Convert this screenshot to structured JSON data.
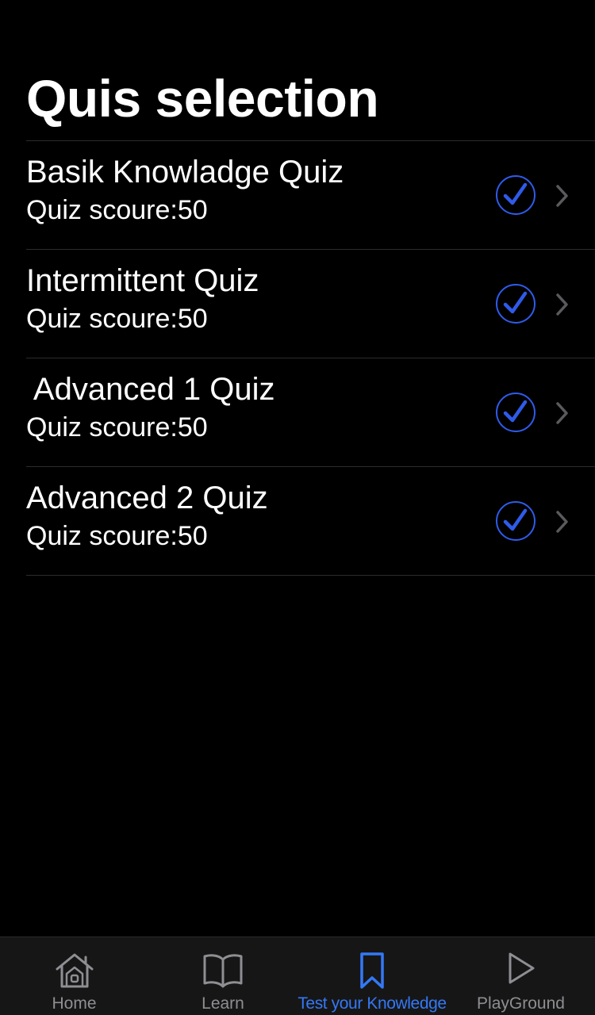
{
  "page": {
    "title": "Quis selection"
  },
  "quizzes": [
    {
      "title": "Basik Knowladge Quiz",
      "score": "Quiz scoure:50",
      "completed": true
    },
    {
      "title": "Intermittent Quiz",
      "score": "Quiz scoure:50",
      "completed": true
    },
    {
      "title": " Advanced 1 Quiz",
      "score": "Quiz scoure:50",
      "completed": true
    },
    {
      "title": "Advanced 2 Quiz",
      "score": "Quiz scoure:50",
      "completed": true
    }
  ],
  "tab_bar": {
    "items": [
      {
        "label": "Home",
        "icon": "house-icon",
        "active": false
      },
      {
        "label": "Learn",
        "icon": "book-icon",
        "active": false
      },
      {
        "label": "Test your Knowledge",
        "icon": "bookmark-icon",
        "active": true
      },
      {
        "label": "PlayGround",
        "icon": "play-icon",
        "active": false
      }
    ]
  },
  "colors": {
    "background": "#000000",
    "accent": "#3478f6",
    "check": "#2f5bea",
    "inactive_tab": "#8e8e93",
    "divider": "#2c2c2e"
  }
}
